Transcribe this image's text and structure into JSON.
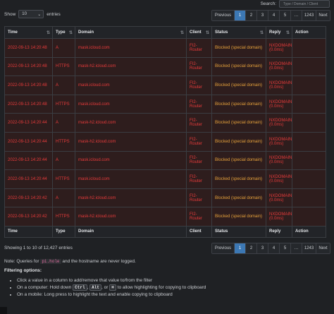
{
  "controls": {
    "show_label": "Show",
    "show_value": "10",
    "entries_label": "entries",
    "search_label": "Search:",
    "search_placeholder": "Type / Domain / Client"
  },
  "pagination": {
    "previous": "Previous",
    "pages": [
      "1",
      "2",
      "3",
      "4",
      "5",
      "…",
      "1243"
    ],
    "active_page": "1",
    "next": "Next"
  },
  "table": {
    "columns": [
      "Time",
      "Type",
      "Domain",
      "Client",
      "Status",
      "Reply",
      "Action"
    ],
    "rows": [
      {
        "time": "2022-09-13 14:20:48",
        "type": "A",
        "domain": "mask.icloud.com",
        "client": "FI2-Router",
        "status": "Blocked (special domain)",
        "reply": "NXDOMAIN (0.0ms)"
      },
      {
        "time": "2022-09-13 14:20:48",
        "type": "HTTPS",
        "domain": "mask-h2.icloud.com",
        "client": "FI2-Router",
        "status": "Blocked (special domain)",
        "reply": "NXDOMAIN (0.0ms)"
      },
      {
        "time": "2022-09-13 14:20:48",
        "type": "A",
        "domain": "mask.icloud.com",
        "client": "FI2-Router",
        "status": "Blocked (special domain)",
        "reply": "NXDOMAIN (0.0ms)"
      },
      {
        "time": "2022-09-13 14:20:48",
        "type": "HTTPS",
        "domain": "mask.icloud.com",
        "client": "FI2-Router",
        "status": "Blocked (special domain)",
        "reply": "NXDOMAIN (0.0ms)"
      },
      {
        "time": "2022-09-13 14:20:44",
        "type": "A",
        "domain": "mask-h2.icloud.com",
        "client": "FI2-Router",
        "status": "Blocked (special domain)",
        "reply": "NXDOMAIN (0.0ms)"
      },
      {
        "time": "2022-09-13 14:20:44",
        "type": "HTTPS",
        "domain": "mask-h2.icloud.com",
        "client": "FI2-Router",
        "status": "Blocked (special domain)",
        "reply": "NXDOMAIN (0.0ms)"
      },
      {
        "time": "2022-09-13 14:20:44",
        "type": "A",
        "domain": "mask.icloud.com",
        "client": "FI2-Router",
        "status": "Blocked (special domain)",
        "reply": "NXDOMAIN (0.0ms)"
      },
      {
        "time": "2022-09-13 14:20:44",
        "type": "HTTPS",
        "domain": "mask.icloud.com",
        "client": "FI2-Router",
        "status": "Blocked (special domain)",
        "reply": "NXDOMAIN (0.0ms)"
      },
      {
        "time": "2022-09-13 14:20:42",
        "type": "A",
        "domain": "mask-h2.icloud.com",
        "client": "FI2-Router",
        "status": "Blocked (special domain)",
        "reply": "NXDOMAIN (0.0ms)"
      },
      {
        "time": "2022-09-13 14:20:42",
        "type": "HTTPS",
        "domain": "mask-h2.icloud.com",
        "client": "FI2-Router",
        "status": "Blocked (special domain)",
        "reply": "NXDOMAIN (0.0ms)"
      }
    ]
  },
  "footer": {
    "info": "Showing 1 to 10 of 12,427 entries",
    "note_prefix": "Note: Queries for",
    "note_code": "pi.hole",
    "note_suffix": "and the hostname are never logged.",
    "filter_title": "Filtering options:",
    "filter_1": "Click a value in a column to add/remove that value to/from the filter",
    "filter_2_prefix": "On a computer: Hold down",
    "key_ctrl": "Ctrl",
    "key_alt": "Alt",
    "key_cmd": "⌘",
    "filter_2_suffix": "to allow highlighting for copying to clipboard",
    "filter_3": "On a mobile: Long press to highlight the text and enable copying to clipboard",
    "sep_comma": ",",
    "sep_or": ", or"
  },
  "colors": {
    "blocked_text": "#e83b3b",
    "status_text": "#e6a23c",
    "active_page": "#3c78b4"
  }
}
